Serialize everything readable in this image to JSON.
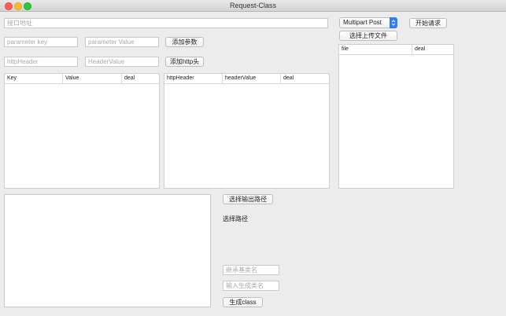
{
  "window": {
    "title": "Request-Class"
  },
  "url_field": {
    "placeholder": "接口地址"
  },
  "params": {
    "key_placeholder": "parameter key",
    "value_placeholder": "parameter Value",
    "add_button": "添加参数",
    "table_headers": [
      "Key",
      "Value",
      "deal"
    ]
  },
  "headers": {
    "key_placeholder": "httpHeader",
    "value_placeholder": "HeaderValue",
    "add_button": "添加http头",
    "table_headers": [
      "httpHeader",
      "headerValue",
      "deal"
    ]
  },
  "request": {
    "method_selected": "Multipart Post",
    "start_button": "开始请求",
    "upload_button": "选择上传文件",
    "file_table_headers": [
      "file",
      "deal"
    ]
  },
  "output": {
    "choose_path_button": "选择输出路径",
    "path_label": "选择路径",
    "base_class_placeholder": "继承基类名",
    "class_name_placeholder": "输入生成类名",
    "generate_button": "生成class"
  },
  "colors": {
    "accent": "#2f7df6",
    "window_bg": "#ececec"
  }
}
